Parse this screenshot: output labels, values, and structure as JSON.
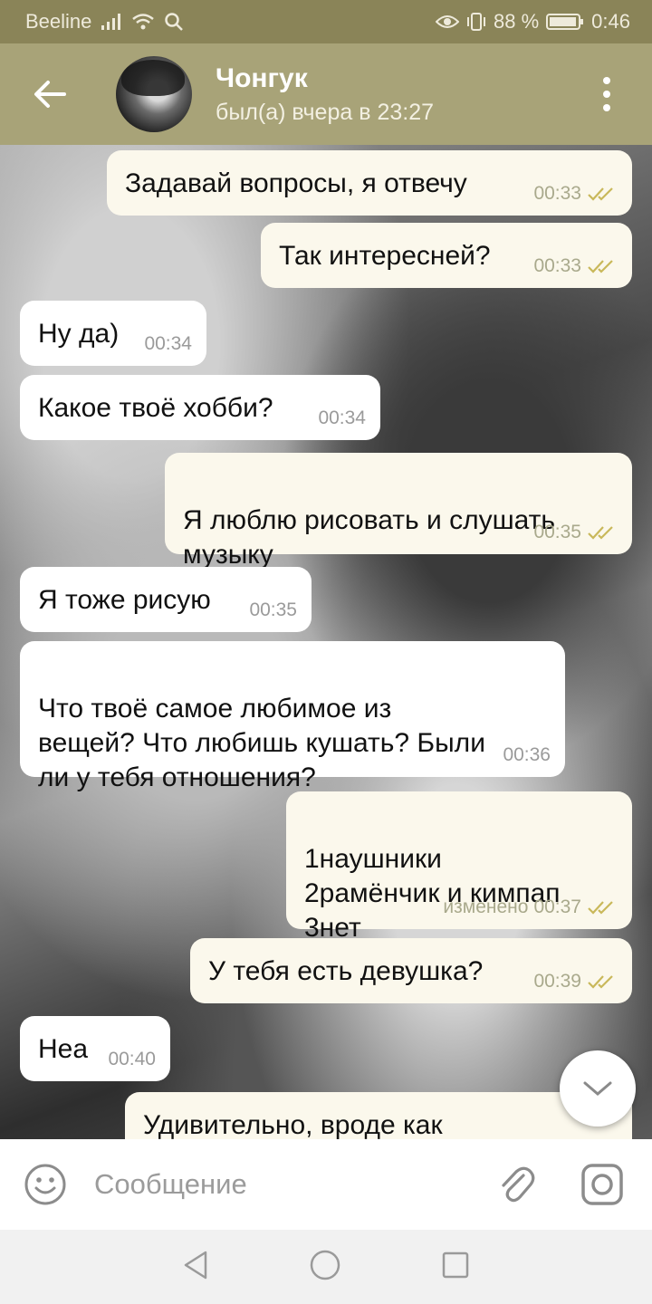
{
  "status_bar": {
    "carrier": "Beeline",
    "battery_percent": "88 %",
    "time": "0:46"
  },
  "header": {
    "contact_name": "Чонгук",
    "last_seen": "был(а) вчера в 23:27",
    "icons": [
      "back-arrow-icon",
      "avatar",
      "more-vert-icon"
    ]
  },
  "messages": [
    {
      "dir": "out",
      "text": "Задавай вопросы, я отвечу",
      "time": "00:33",
      "edited": ""
    },
    {
      "dir": "out",
      "text": "Так интересней?",
      "time": "00:33",
      "edited": ""
    },
    {
      "dir": "in",
      "text": "Ну да)",
      "time": "00:34",
      "edited": ""
    },
    {
      "dir": "in",
      "text": "Какое твоё хобби?",
      "time": "00:34",
      "edited": ""
    },
    {
      "dir": "out",
      "text": "Я люблю рисовать и слушать\nмузыку",
      "time": "00:35",
      "edited": ""
    },
    {
      "dir": "in",
      "text": "Я тоже рисую",
      "time": "00:35",
      "edited": ""
    },
    {
      "dir": "in",
      "text": "Что твоё самое любимое из\nвещей? Что любишь кушать? Были\nли у тебя отношения?",
      "time": "00:36",
      "edited": ""
    },
    {
      "dir": "out",
      "text": "1наушники\n2рамёнчик и кимпап\n3нет",
      "time": "00:37",
      "edited": "изменено"
    },
    {
      "dir": "out",
      "text": "У тебя есть девушка?",
      "time": "00:39",
      "edited": ""
    },
    {
      "dir": "in",
      "text": "Неа",
      "time": "00:40",
      "edited": ""
    },
    {
      "dir": "out",
      "text": "Удивительно, вроде как",
      "time": "",
      "edited": ""
    }
  ],
  "composer": {
    "placeholder": "Сообщение"
  },
  "colors": {
    "status_bar": "#8a8458",
    "app_bar": "#a8a378",
    "incoming_bubble": "#ffffff",
    "outgoing_bubble": "#fbf8ec",
    "read_checks": "#c9b85a"
  }
}
